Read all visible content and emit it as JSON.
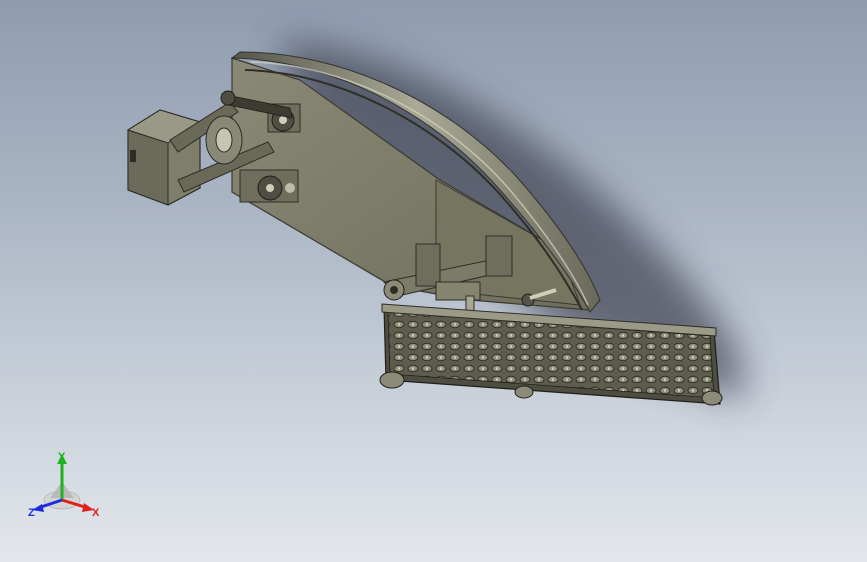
{
  "triad": {
    "x_label": "X",
    "y_label": "Y",
    "z_label": "Z",
    "colors": {
      "x": "#e0201c",
      "y": "#1fb21f",
      "z": "#1c2de0"
    }
  },
  "model": {
    "body_color": "#7d7c69",
    "body_dark": "#5f5e4f",
    "body_light": "#a4a38f",
    "shadow_color": "#3c4150"
  }
}
